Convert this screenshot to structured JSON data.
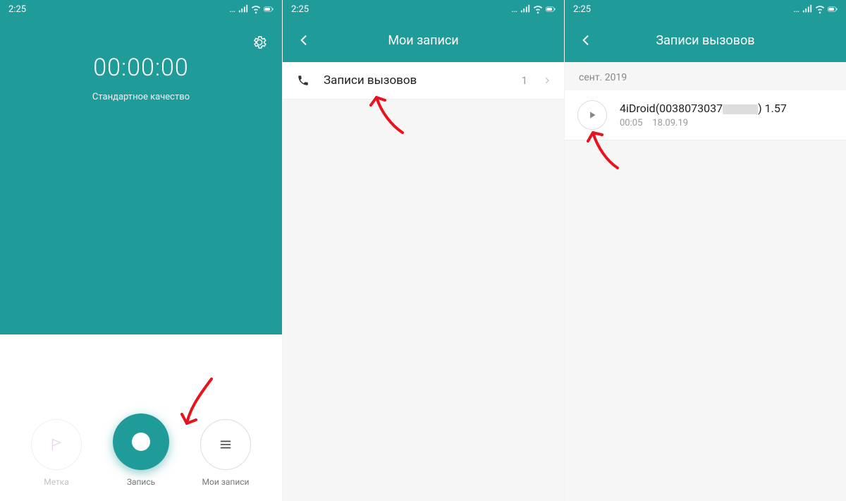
{
  "status": {
    "time": "2:25"
  },
  "screen1": {
    "timer": "00:00:00",
    "quality": "Стандартное качество",
    "controls": {
      "flag_label": "Метка",
      "record_label": "Запись",
      "recordings_label": "Мои записи"
    }
  },
  "screen2": {
    "title": "Мои записи",
    "row": {
      "label": "Записи вызовов",
      "count": "1"
    }
  },
  "screen3": {
    "title": "Записи вызовов",
    "section": "сент. 2019",
    "recording": {
      "name_prefix": "4iDroid(0038073037",
      "name_suffix": ") 1.57",
      "duration": "00:05",
      "date": "18.09.19"
    }
  }
}
